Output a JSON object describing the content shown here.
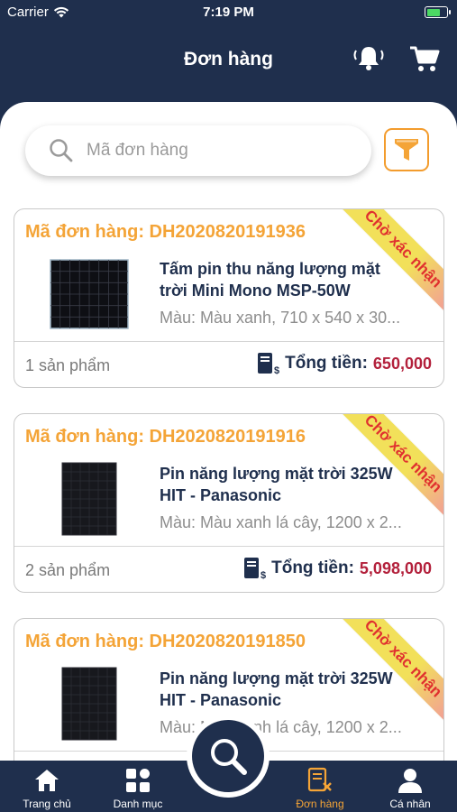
{
  "status_bar": {
    "carrier": "Carrier",
    "time": "7:19 PM",
    "battery_level": 0.7
  },
  "header": {
    "title": "Đơn hàng",
    "bell_icon": "bell-icon",
    "cart_icon": "cart-icon"
  },
  "search": {
    "placeholder": "Mã đơn hàng",
    "value": "",
    "filter_icon": "filter-icon"
  },
  "colors": {
    "navy": "#1f2f4d",
    "orange": "#f4a437",
    "total_red": "#b3213c",
    "ribbon_yellow": "#f2e55b",
    "ribbon_text": "#e0312f"
  },
  "orders": [
    {
      "code": "Mã đơn hàng: DH2020820191936",
      "status": "Chờ xác nhận",
      "product_line1": "Tấm pin thu năng lượng mặt",
      "product_line2": "trời Mini Mono MSP-50W",
      "variant": "Màu: Màu xanh, 710 x 540 x 30...",
      "quantity": "1 sản phẩm",
      "total_label": "Tổng tiền:",
      "total_value": "650,000"
    },
    {
      "code": "Mã đơn hàng: DH2020820191916",
      "status": "Chờ xác nhận",
      "product_line1": "Pin năng lượng mặt trời 325W",
      "product_line2": "HIT - Panasonic",
      "variant": "Màu: Màu xanh lá cây, 1200 x 2...",
      "quantity": "2 sản phẩm",
      "total_label": "Tổng tiền:",
      "total_value": "5,098,000"
    },
    {
      "code": "Mã đơn hàng: DH2020820191850",
      "status": "Chờ xác nhận",
      "product_line1": "Pin năng lượng mặt trời 325W",
      "product_line2": "HIT - Panasonic",
      "variant": "Màu: Màu xanh lá cây, 1200 x 2...",
      "quantity": "",
      "total_label": "",
      "total_value": ""
    }
  ],
  "bottom_nav": {
    "home": "Trang chủ",
    "categories": "Danh mục",
    "orders": "Đơn hàng",
    "profile": "Cá nhân",
    "active": "orders"
  }
}
